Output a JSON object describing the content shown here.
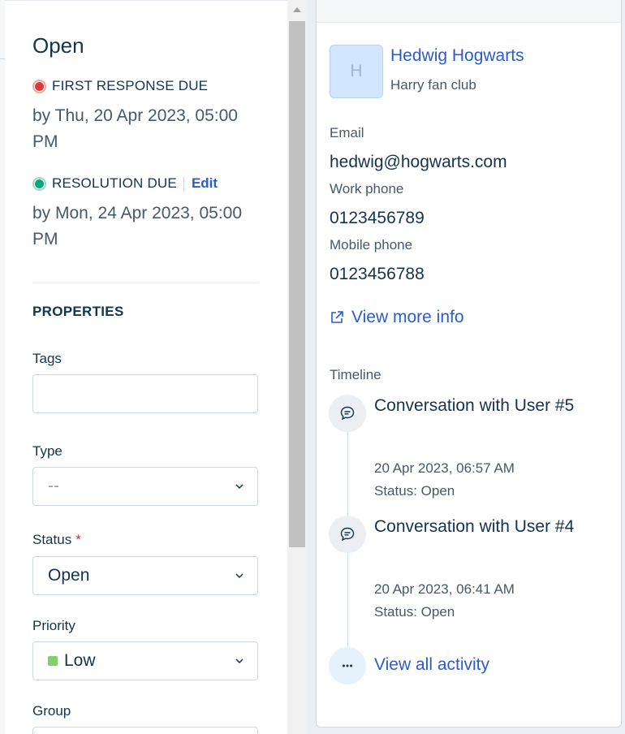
{
  "ticket": {
    "status_title": "Open",
    "first_response": {
      "label": "FIRST RESPONSE DUE",
      "date": "by Thu, 20 Apr 2023, 05:00 PM"
    },
    "resolution": {
      "label": "RESOLUTION DUE",
      "edit_label": "Edit",
      "date": "by Mon, 24 Apr 2023, 05:00 PM"
    }
  },
  "properties": {
    "section_title": "PROPERTIES",
    "tags": {
      "label": "Tags",
      "value": ""
    },
    "type": {
      "label": "Type",
      "value": "--"
    },
    "status": {
      "label": "Status",
      "required_mark": "*",
      "value": "Open"
    },
    "priority": {
      "label": "Priority",
      "value": "Low",
      "color": "#7fd26a"
    },
    "group": {
      "label": "Group",
      "value": ""
    }
  },
  "contact": {
    "avatar_letter": "H",
    "name": "Hedwig Hogwarts",
    "org": "Harry fan club",
    "email_label": "Email",
    "email": "hedwig@hogwarts.com",
    "work_phone_label": "Work phone",
    "work_phone": "0123456789",
    "mobile_phone_label": "Mobile phone",
    "mobile_phone": "0123456788",
    "view_more": "View more info"
  },
  "timeline": {
    "label": "Timeline",
    "items": [
      {
        "title": "Conversation with User #5",
        "date": "20 Apr 2023, 06:57 AM",
        "status": "Status: Open"
      },
      {
        "title": "Conversation with User #4",
        "date": "20 Apr 2023, 06:41 AM",
        "status": "Status: Open"
      }
    ],
    "view_all": "View all activity"
  },
  "colors": {
    "accent": "#2c5cc5",
    "overdue": "#e43538",
    "on_track": "#00a886"
  }
}
